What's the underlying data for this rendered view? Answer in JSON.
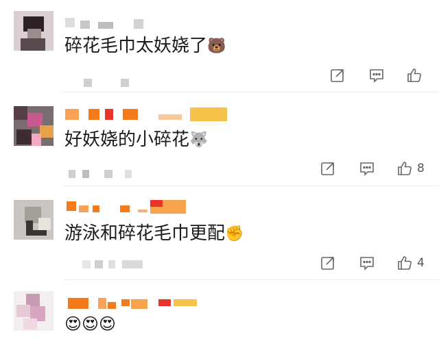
{
  "comments": [
    {
      "text": "碎花毛巾太妖娆了",
      "emoji": "🐻",
      "like_count": ""
    },
    {
      "text": "好妖娆的小碎花",
      "emoji": "🐺",
      "like_count": "8"
    },
    {
      "text": "游泳和碎花毛巾更配",
      "emoji": "✊",
      "like_count": "4"
    },
    {
      "text": "",
      "emoji": "😍😍😍",
      "like_count": ""
    }
  ],
  "icons": {
    "share": "share-icon",
    "reply": "comment-icon",
    "like": "thumbs-up-icon"
  },
  "colors": {
    "blur_orange": "#f47a1a",
    "blur_red": "#e8342a",
    "blur_gold": "#f6c34a",
    "blur_gray": "#cfcfcf"
  }
}
